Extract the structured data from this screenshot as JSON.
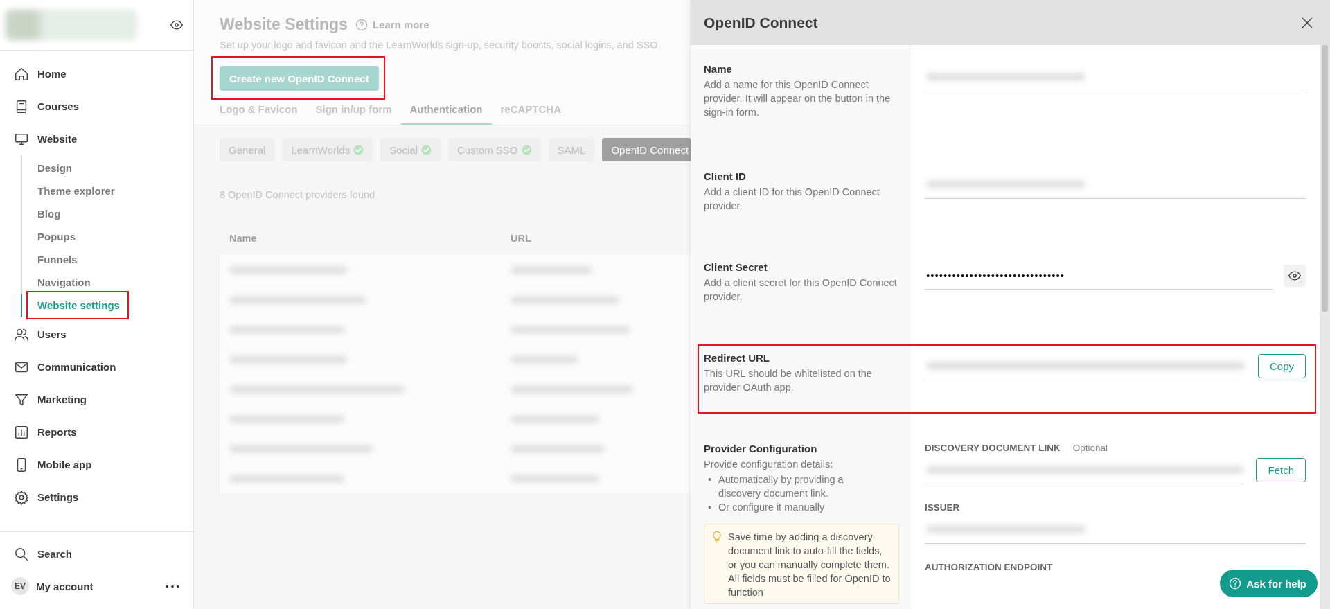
{
  "sidebar": {
    "nav": [
      {
        "label": "Home",
        "selected": false
      },
      {
        "label": "Courses",
        "selected": false
      },
      {
        "label": "Website",
        "selected": false,
        "children": [
          {
            "label": "Design",
            "selected": false,
            "highlighted": false
          },
          {
            "label": "Theme explorer",
            "selected": false,
            "highlighted": false
          },
          {
            "label": "Blog",
            "selected": false,
            "highlighted": false
          },
          {
            "label": "Popups",
            "selected": false,
            "highlighted": false
          },
          {
            "label": "Funnels",
            "selected": false,
            "highlighted": false
          },
          {
            "label": "Navigation",
            "selected": false,
            "highlighted": false
          },
          {
            "label": "Website settings",
            "selected": true,
            "highlighted": true
          }
        ]
      },
      {
        "label": "Users",
        "selected": false
      },
      {
        "label": "Communication",
        "selected": false
      },
      {
        "label": "Marketing",
        "selected": false
      },
      {
        "label": "Reports",
        "selected": false
      },
      {
        "label": "Mobile app",
        "selected": false
      },
      {
        "label": "Settings",
        "selected": false
      }
    ],
    "search": "Search",
    "account": {
      "initials": "EV",
      "label": "My account"
    }
  },
  "main": {
    "title": "Website Settings",
    "learn_more": "Learn more",
    "subtitle": "Set up your logo and favicon and the LearnWorlds sign-up, security boosts, social logins, and SSO.",
    "create_button": {
      "label": "Create new OpenID Connect",
      "highlighted": true
    },
    "tabs": [
      {
        "label": "Logo & Favicon",
        "selected": false
      },
      {
        "label": "Sign in/up form",
        "selected": false
      },
      {
        "label": "Authentication",
        "selected": true
      },
      {
        "label": "reCAPTCHA",
        "selected": false
      }
    ],
    "pills": [
      {
        "label": "General",
        "verified": false,
        "selected": false
      },
      {
        "label": "LearnWorlds",
        "verified": true,
        "selected": false
      },
      {
        "label": "Social",
        "verified": true,
        "selected": false
      },
      {
        "label": "Custom SSO",
        "verified": true,
        "selected": false
      },
      {
        "label": "SAML",
        "verified": false,
        "selected": false
      },
      {
        "label": "OpenID Connect",
        "verified": false,
        "selected": true
      }
    ],
    "count": "8 OpenID Connect providers found",
    "table": {
      "columns": [
        "Name",
        "URL"
      ],
      "rows": [
        {
          "kind": "redacted"
        },
        {
          "kind": "redacted"
        },
        {
          "kind": "redacted"
        },
        {
          "kind": "redacted"
        },
        {
          "kind": "redacted"
        },
        {
          "kind": "redacted"
        },
        {
          "kind": "redacted"
        },
        {
          "kind": "redacted"
        }
      ]
    }
  },
  "panel": {
    "title": "OpenID Connect",
    "sections": [
      {
        "label": "Name",
        "description": "Add a name for this OpenID Connect provider. It will appear on the button in the sign-in form.",
        "highlighted": false,
        "field": {
          "kind": "redacted"
        }
      },
      {
        "label": "Client ID",
        "description": "Add a client ID for this OpenID Connect provider.",
        "highlighted": false,
        "field": {
          "kind": "redacted"
        }
      },
      {
        "label": "Client Secret",
        "description": "Add a client secret for this OpenID Connect provider.",
        "highlighted": false,
        "field": {
          "kind": "secret",
          "value": "••••••••••••••••••••••••••••••••"
        }
      },
      {
        "label": "Redirect URL",
        "description": "This URL should be whitelisted on the provider OAuth app.",
        "highlighted": true,
        "field": {
          "kind": "redacted",
          "button": "Copy"
        }
      }
    ],
    "provider": {
      "label": "Provider Configuration",
      "description": "Provide configuration details:",
      "bullets": [
        {
          "marker": "•",
          "text": "Automatically by providing a discovery document link."
        },
        {
          "marker": "•",
          "text": "Or configure it manually"
        }
      ],
      "hint": "Save time by adding a discovery document link to auto-fill the fields, or you can manually complete them. All fields must be filled for OpenID to function",
      "fields": [
        {
          "label": "DISCOVERY DOCUMENT LINK",
          "note": "Optional",
          "kind": "redacted",
          "button": "Fetch"
        },
        {
          "label": "ISSUER",
          "kind": "redacted"
        },
        {
          "label": "AUTHORIZATION ENDPOINT"
        }
      ]
    }
  },
  "help_button": "Ask for help"
}
